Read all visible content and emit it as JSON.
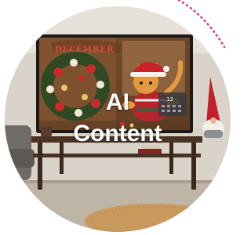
{
  "badge": {
    "line1": "AI",
    "line2": "Content"
  },
  "artwork": {
    "banner_text": "DECEMBER",
    "calendar_number": "12",
    "subject": "cat-in-christmas-sweater-on-tv",
    "accent_color": "#e8336d"
  }
}
